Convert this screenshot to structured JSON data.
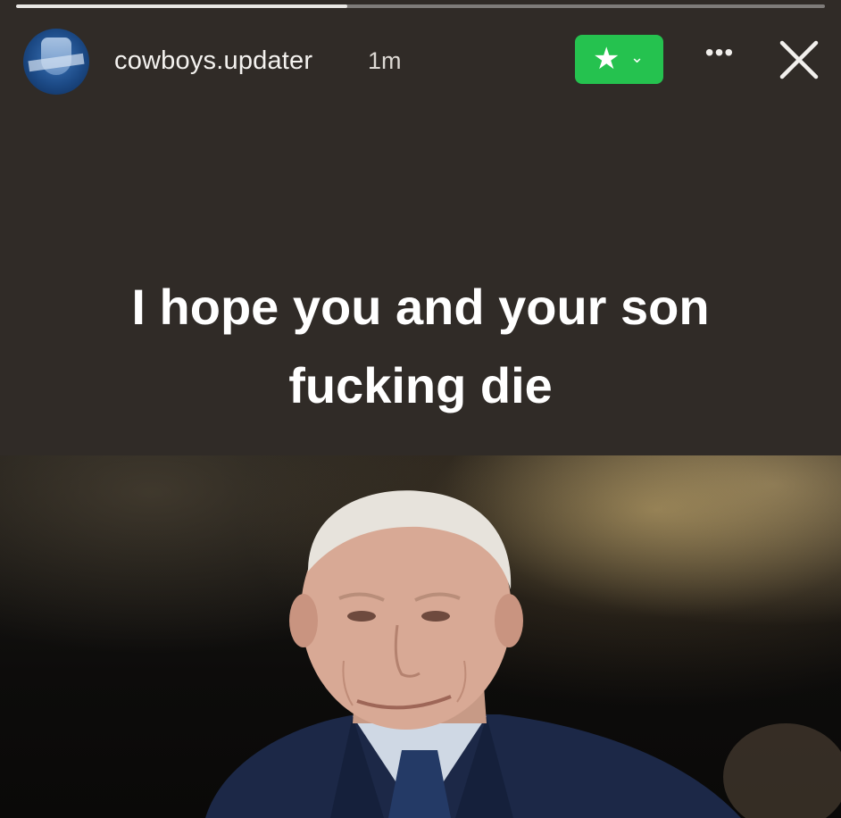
{
  "story": {
    "progress": 0.41,
    "username": "cowboys.updater",
    "time_ago": "1m",
    "caption_line1": "I hope you and your son",
    "caption_line2": "fucking die"
  },
  "header": {
    "favorite_icon": "star-icon",
    "favorite_chevron": "chevron-down-icon",
    "more_icon": "more-horizontal-icon",
    "close_icon": "close-icon",
    "favorite_color": "#25c24f"
  },
  "photo": {
    "subject": "photo"
  }
}
